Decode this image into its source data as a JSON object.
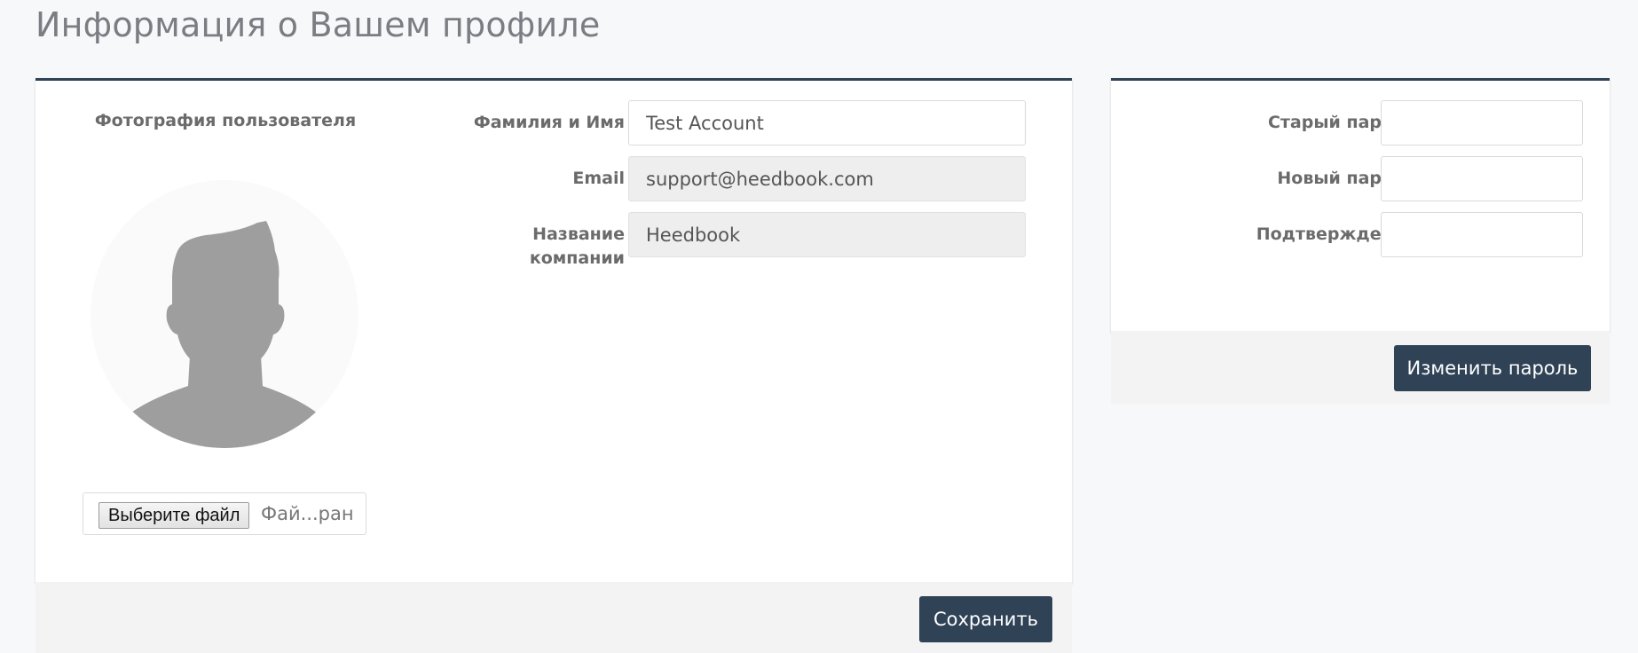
{
  "page": {
    "title": "Информация о Вашем профиле"
  },
  "profile": {
    "photo_label": "Фотография пользователя",
    "file_button_label": "Выберите файл",
    "file_status": "Фай...ран",
    "fields": [
      {
        "label": "Фамилия и Имя",
        "value": "Test Account",
        "readonly": false
      },
      {
        "label": "Email",
        "value": "support@heedbook.com",
        "readonly": true
      },
      {
        "label": "Название компании",
        "value": "Heedbook",
        "readonly": true
      }
    ],
    "save_label": "Сохранить"
  },
  "password": {
    "fields": [
      {
        "label": "Старый пароль",
        "value": ""
      },
      {
        "label": "Новый пароль",
        "value": ""
      },
      {
        "label": "Подтверждение",
        "value": ""
      }
    ],
    "change_label": "Изменить пароль"
  },
  "colors": {
    "accent": "#2f4256",
    "background": "#f7f8fa",
    "card": "#ffffff",
    "footer": "#f3f3f3",
    "readonly_input": "#eeeeee",
    "avatar_circle": "#fafafa",
    "avatar_silhouette": "#9e9e9e"
  },
  "icons": {
    "avatar": "default-user-avatar-icon"
  }
}
